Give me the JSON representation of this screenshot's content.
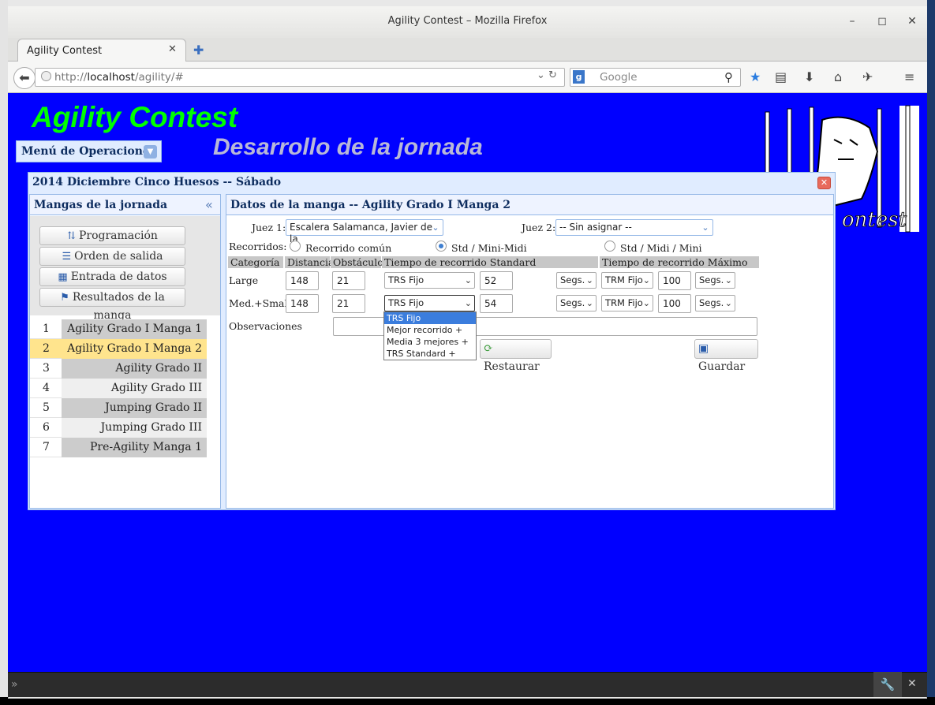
{
  "browser": {
    "window_title": "Agility Contest – Mozilla Firefox",
    "tab_label": "Agility Contest",
    "url_prefix": "http://",
    "url_host": "localhost",
    "url_path": "/agility/#",
    "search_placeholder": "Google"
  },
  "app": {
    "title": "Agility Contest",
    "subtitle": "Desarrollo de la jornada",
    "menu_label": "Menú de Operaciones"
  },
  "panel": {
    "title": "2014 Diciembre Cinco Huesos -- Sábado"
  },
  "west": {
    "title": "Mangas de la jornada",
    "buttons": [
      {
        "icon": "⇅",
        "label": "Programación"
      },
      {
        "icon": "☰",
        "label": "Orden de salida"
      },
      {
        "icon": "▦",
        "label": "Entrada de datos"
      },
      {
        "icon": "⚑",
        "label": "Resultados de la manga"
      }
    ],
    "rows": [
      {
        "num": "1",
        "name": "Agility Grado I Manga 1"
      },
      {
        "num": "2",
        "name": "Agility Grado I Manga 2"
      },
      {
        "num": "3",
        "name": "Agility Grado II"
      },
      {
        "num": "4",
        "name": "Agility Grado III"
      },
      {
        "num": "5",
        "name": "Jumping Grado II"
      },
      {
        "num": "6",
        "name": "Jumping Grado III"
      },
      {
        "num": "7",
        "name": "Pre-Agility Manga 1"
      }
    ],
    "selected_row": 2,
    "colors": {
      "selected": "#ffe48d",
      "odd": "#cccccc",
      "even": "#efefef"
    }
  },
  "form": {
    "title": "Datos de la manga -- Agility Grado I Manga 2",
    "juez1_label": "Juez 1:",
    "juez1_value": "Escalera Salamanca, Javier de la",
    "juez2_label": "Juez 2:",
    "juez2_value": "-- Sin asignar --",
    "recorridos_label": "Recorridos:",
    "recorridos_options": [
      "Recorrido común",
      "Std / Mini-Midi",
      "Std / Midi / Mini"
    ],
    "recorridos_selected": 1,
    "headers": {
      "categoria": "Categoría",
      "distancia": "Distancia",
      "obstaculos": "Obstáculos",
      "trs": "Tiempo de recorrido Standard",
      "trm": "Tiempo de recorrido Máximo"
    },
    "rows": [
      {
        "categoria": "Large",
        "distancia": "148",
        "obstaculos": "21",
        "trs_tipo": "TRS Fijo",
        "trs_valor": "52",
        "trs_unidad": "Segs.",
        "trm_tipo": "TRM Fijo",
        "trm_valor": "100",
        "trm_unidad": "Segs."
      },
      {
        "categoria": "Med.+Small",
        "distancia": "148",
        "obstaculos": "21",
        "trs_tipo": "TRS Fijo",
        "trs_valor": "54",
        "trs_unidad": "Segs.",
        "trm_tipo": "TRM Fijo",
        "trm_valor": "100",
        "trm_unidad": "Segs."
      }
    ],
    "observaciones_label": "Observaciones",
    "observaciones_value": "",
    "dropdown_options": [
      "TRS Fijo",
      "Mejor recorrido +",
      "Media 3 mejores +",
      "TRS Standard +"
    ],
    "dropdown_selected": 0,
    "restaurar_label": "Restaurar",
    "guardar_label": "Guardar"
  }
}
